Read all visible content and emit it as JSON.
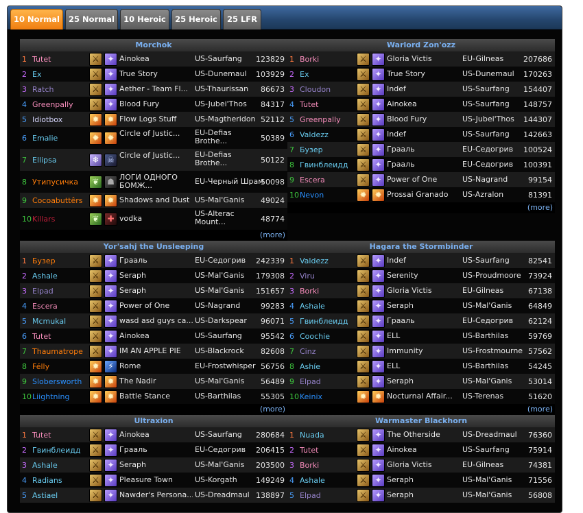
{
  "tabs": [
    "10 Normal",
    "25 Normal",
    "10 Heroic",
    "25 Heroic",
    "25 LFR"
  ],
  "active_tab": 0,
  "more_label": "(more)",
  "colors": {
    "tab_active": "#f07e10",
    "header_text": "#7ab0f0",
    "rank": [
      "#ff7a40",
      "#c86cff",
      "#c86cff",
      "#4aa0ff",
      "#4aa0ff",
      "#4aa0ff",
      "#3ec83e",
      "#3ec83e",
      "#3ec83e",
      "#3ec83e"
    ],
    "class": {
      "paladin": "#f58cba",
      "mage": "#69ccf0",
      "warlock": "#9482c9",
      "priest": "#d8d8ff",
      "druid": "#ff7d0a",
      "deathknight": "#c41f3b",
      "shaman": "#2a90ff",
      "rogue": "#fff569",
      "hunter": "#abd473",
      "warrior": "#c79c6e",
      "monk": "#00ff96"
    }
  },
  "bosses": [
    {
      "name": "Morchok",
      "rows": [
        {
          "rank": "1",
          "player": "Tutet",
          "cls": "paladin",
          "guild": "Ainokea",
          "realm": "US-Saurfang",
          "score": "123829",
          "icons": [
            "pal",
            "arcane"
          ]
        },
        {
          "rank": "2",
          "player": "Ex",
          "cls": "mage",
          "guild": "True Story",
          "realm": "US-Dunemaul",
          "score": "103929",
          "icons": [
            "pal",
            "arcane"
          ]
        },
        {
          "rank": "3",
          "player": "Ratch",
          "cls": "warlock",
          "guild": "Aether - Team Fl...",
          "realm": "US-Thaurissan",
          "score": "86673",
          "icons": [
            "pal",
            "arcane"
          ]
        },
        {
          "rank": "4",
          "player": "Greenpally",
          "cls": "paladin",
          "guild": "Blood Fury",
          "realm": "US-Jubei'Thos",
          "score": "84317",
          "icons": [
            "pal",
            "arcane"
          ]
        },
        {
          "rank": "5",
          "player": "Idiotbox",
          "cls": "priest",
          "guild": "Flow Logs Stuff",
          "realm": "US-Magtheridon",
          "score": "52112",
          "icons": [
            "fire",
            "fire"
          ]
        },
        {
          "rank": "6",
          "player": "Emalie",
          "cls": "mage",
          "guild": "Circle of Justic...",
          "realm": "EU-Defias Brothe...",
          "score": "50389",
          "icons": [
            "fire",
            "fire"
          ],
          "tall": true
        },
        {
          "rank": "7",
          "player": "Ellipsa",
          "cls": "mage",
          "guild": "Circle of Justic...",
          "realm": "EU-Defias Brothe...",
          "score": "50122",
          "icons": [
            "frost",
            "dk"
          ],
          "tall": true
        },
        {
          "rank": "8",
          "player": "Утипусичка",
          "cls": "druid",
          "guild": "ЛОГИ ОДНОГО БОМЖ...",
          "realm": "EU-Черный Шрам",
          "score": "50098",
          "icons": [
            "nature",
            "dark"
          ],
          "tall": true
        },
        {
          "rank": "9",
          "player": "Cocoabuttêrs",
          "cls": "druid",
          "guild": "Shadows and Dust",
          "realm": "US-Mal'Ganis",
          "score": "49024",
          "icons": [
            "fire",
            "fire"
          ]
        },
        {
          "rank": "10",
          "player": "Killars",
          "cls": "deathknight",
          "guild": "vodka",
          "realm": "US-Alterac Mount...",
          "score": "48774",
          "icons": [
            "nature",
            "blood"
          ],
          "tall": true
        }
      ]
    },
    {
      "name": "Warlord Zon'ozz",
      "rows": [
        {
          "rank": "1",
          "player": "Borki",
          "cls": "paladin",
          "guild": "Gloria Victis",
          "realm": "EU-Gilneas",
          "score": "207686",
          "icons": [
            "pal",
            "arcane"
          ]
        },
        {
          "rank": "2",
          "player": "Ex",
          "cls": "mage",
          "guild": "True Story",
          "realm": "US-Dunemaul",
          "score": "170263",
          "icons": [
            "pal",
            "arcane"
          ]
        },
        {
          "rank": "3",
          "player": "Cloudon",
          "cls": "warlock",
          "guild": "Indef",
          "realm": "US-Saurfang",
          "score": "154407",
          "icons": [
            "pal",
            "arcane"
          ]
        },
        {
          "rank": "4",
          "player": "Tutet",
          "cls": "paladin",
          "guild": "Ainokea",
          "realm": "US-Saurfang",
          "score": "148757",
          "icons": [
            "pal",
            "arcane"
          ]
        },
        {
          "rank": "5",
          "player": "Greenpally",
          "cls": "paladin",
          "guild": "Blood Fury",
          "realm": "US-Jubei'Thos",
          "score": "144307",
          "icons": [
            "pal",
            "arcane"
          ]
        },
        {
          "rank": "6",
          "player": "Valdezz",
          "cls": "mage",
          "guild": "Indef",
          "realm": "US-Saurfang",
          "score": "142663",
          "icons": [
            "pal",
            "arcane"
          ]
        },
        {
          "rank": "7",
          "player": "Бузер",
          "cls": "mage",
          "guild": "Грааль",
          "realm": "EU-Седогрив",
          "score": "100524",
          "icons": [
            "pal",
            "arcane"
          ]
        },
        {
          "rank": "8",
          "player": "Гвинблеидд",
          "cls": "mage",
          "guild": "Грааль",
          "realm": "EU-Седогрив",
          "score": "100391",
          "icons": [
            "pal",
            "arcane"
          ]
        },
        {
          "rank": "9",
          "player": "Escera",
          "cls": "paladin",
          "guild": "Power of One",
          "realm": "US-Nagrand",
          "score": "99154",
          "icons": [
            "pal",
            "arcane"
          ]
        },
        {
          "rank": "10",
          "player": "Nevon",
          "cls": "shaman",
          "guild": "Prossai Granado",
          "realm": "US-Azralon",
          "score": "81391",
          "icons": [
            "fire",
            "fire"
          ]
        }
      ]
    },
    {
      "name": "Yor'sahj the Unsleeping",
      "rows": [
        {
          "rank": "1",
          "player": "Бузер",
          "cls": "druid",
          "guild": "Грааль",
          "realm": "EU-Седогрив",
          "score": "242339",
          "icons": [
            "pal",
            "arcane"
          ]
        },
        {
          "rank": "2",
          "player": "Ashale",
          "cls": "mage",
          "guild": "Seraph",
          "realm": "US-Mal'Ganis",
          "score": "179308",
          "icons": [
            "pal",
            "arcane"
          ]
        },
        {
          "rank": "3",
          "player": "Elpad",
          "cls": "warlock",
          "guild": "Seraph",
          "realm": "US-Mal'Ganis",
          "score": "151657",
          "icons": [
            "pal",
            "arcane"
          ]
        },
        {
          "rank": "4",
          "player": "Escera",
          "cls": "paladin",
          "guild": "Power of One",
          "realm": "US-Nagrand",
          "score": "99283",
          "icons": [
            "pal",
            "arcane"
          ]
        },
        {
          "rank": "5",
          "player": "Mcmukal",
          "cls": "mage",
          "guild": "wasd asd guys ca...",
          "realm": "US-Darkspear",
          "score": "96071",
          "icons": [
            "pal",
            "arcane"
          ]
        },
        {
          "rank": "6",
          "player": "Tutet",
          "cls": "paladin",
          "guild": "Ainokea",
          "realm": "US-Saurfang",
          "score": "95542",
          "icons": [
            "pal",
            "arcane"
          ]
        },
        {
          "rank": "7",
          "player": "Thaumatrope",
          "cls": "druid",
          "guild": "IM AN APPLE PIE",
          "realm": "US-Blackrock",
          "score": "82608",
          "icons": [
            "pal",
            "arcane"
          ]
        },
        {
          "rank": "8",
          "player": "Félly",
          "cls": "druid",
          "guild": "Rome",
          "realm": "EU-Frostwhisper",
          "score": "56756",
          "icons": [
            "fire",
            "blue"
          ]
        },
        {
          "rank": "9",
          "player": "Slobersworth",
          "cls": "shaman",
          "guild": "The Nadir",
          "realm": "US-Mal'Ganis",
          "score": "56489",
          "icons": [
            "fire",
            "fire"
          ]
        },
        {
          "rank": "10",
          "player": "Liightning",
          "cls": "shaman",
          "guild": "Battle Stance",
          "realm": "US-Barthilas",
          "score": "55305",
          "icons": [
            "fire",
            "fire"
          ]
        }
      ]
    },
    {
      "name": "Hagara the Stormbinder",
      "rows": [
        {
          "rank": "1",
          "player": "Valdezz",
          "cls": "mage",
          "guild": "Indef",
          "realm": "US-Saurfang",
          "score": "82541",
          "icons": [
            "pal",
            "arcane"
          ]
        },
        {
          "rank": "2",
          "player": "Viru",
          "cls": "warlock",
          "guild": "Serenity",
          "realm": "US-Proudmoore",
          "score": "73924",
          "icons": [
            "pal",
            "arcane"
          ]
        },
        {
          "rank": "3",
          "player": "Borki",
          "cls": "paladin",
          "guild": "Gloria Victis",
          "realm": "EU-Gilneas",
          "score": "67138",
          "icons": [
            "pal",
            "arcane"
          ]
        },
        {
          "rank": "4",
          "player": "Ashale",
          "cls": "mage",
          "guild": "Seraph",
          "realm": "US-Mal'Ganis",
          "score": "64849",
          "icons": [
            "pal",
            "arcane"
          ]
        },
        {
          "rank": "5",
          "player": "Гвинблеидд",
          "cls": "mage",
          "guild": "Грааль",
          "realm": "EU-Седогрив",
          "score": "62124",
          "icons": [
            "pal",
            "arcane"
          ]
        },
        {
          "rank": "6",
          "player": "Coochie",
          "cls": "mage",
          "guild": "ELL",
          "realm": "US-Barthilas",
          "score": "59769",
          "icons": [
            "pal",
            "arcane"
          ]
        },
        {
          "rank": "7",
          "player": "Cinz",
          "cls": "warlock",
          "guild": "Immunity",
          "realm": "US-Frostmourne",
          "score": "57562",
          "icons": [
            "pal",
            "arcane"
          ]
        },
        {
          "rank": "8",
          "player": "Ashíe",
          "cls": "mage",
          "guild": "ELL",
          "realm": "US-Barthilas",
          "score": "54245",
          "icons": [
            "pal",
            "arcane"
          ]
        },
        {
          "rank": "9",
          "player": "Elpad",
          "cls": "warlock",
          "guild": "Seraph",
          "realm": "US-Mal'Ganis",
          "score": "53014",
          "icons": [
            "pal",
            "arcane"
          ]
        },
        {
          "rank": "10",
          "player": "Keinix",
          "cls": "shaman",
          "guild": "Nocturnal Affair...",
          "realm": "US-Terenas",
          "score": "51620",
          "icons": [
            "fire",
            "fire"
          ]
        }
      ]
    },
    {
      "name": "Ultraxion",
      "rows": [
        {
          "rank": "1",
          "player": "Tutet",
          "cls": "paladin",
          "guild": "Ainokea",
          "realm": "US-Saurfang",
          "score": "280684",
          "icons": [
            "pal",
            "arcane"
          ]
        },
        {
          "rank": "2",
          "player": "Гвинблеидд",
          "cls": "mage",
          "guild": "Грааль",
          "realm": "EU-Седогрив",
          "score": "206415",
          "icons": [
            "pal",
            "arcane"
          ]
        },
        {
          "rank": "3",
          "player": "Ashale",
          "cls": "mage",
          "guild": "Seraph",
          "realm": "US-Mal'Ganis",
          "score": "203500",
          "icons": [
            "pal",
            "arcane"
          ]
        },
        {
          "rank": "4",
          "player": "Radians",
          "cls": "mage",
          "guild": "Pleasure Town",
          "realm": "US-Korgath",
          "score": "149249",
          "icons": [
            "pal",
            "arcane"
          ]
        },
        {
          "rank": "5",
          "player": "Astiael",
          "cls": "mage",
          "guild": "Nawder's Persona...",
          "realm": "US-Dreadmaul",
          "score": "138897",
          "icons": [
            "pal",
            "arcane"
          ]
        }
      ]
    },
    {
      "name": "Warmaster Blackhorn",
      "rows": [
        {
          "rank": "1",
          "player": "Nuada",
          "cls": "mage",
          "guild": "The Otherside",
          "realm": "US-Dreadmaul",
          "score": "76360",
          "icons": [
            "pal",
            "arcane"
          ]
        },
        {
          "rank": "2",
          "player": "Tutet",
          "cls": "paladin",
          "guild": "Ainokea",
          "realm": "US-Saurfang",
          "score": "75914",
          "icons": [
            "pal",
            "arcane"
          ]
        },
        {
          "rank": "3",
          "player": "Borki",
          "cls": "paladin",
          "guild": "Gloria Victis",
          "realm": "EU-Gilneas",
          "score": "74381",
          "icons": [
            "pal",
            "arcane"
          ]
        },
        {
          "rank": "4",
          "player": "Ashale",
          "cls": "mage",
          "guild": "Seraph",
          "realm": "US-Mal'Ganis",
          "score": "71556",
          "icons": [
            "pal",
            "arcane"
          ]
        },
        {
          "rank": "5",
          "player": "Elpad",
          "cls": "warlock",
          "guild": "Seraph",
          "realm": "US-Mal'Ganis",
          "score": "56808",
          "icons": [
            "pal",
            "arcane"
          ]
        }
      ]
    }
  ]
}
